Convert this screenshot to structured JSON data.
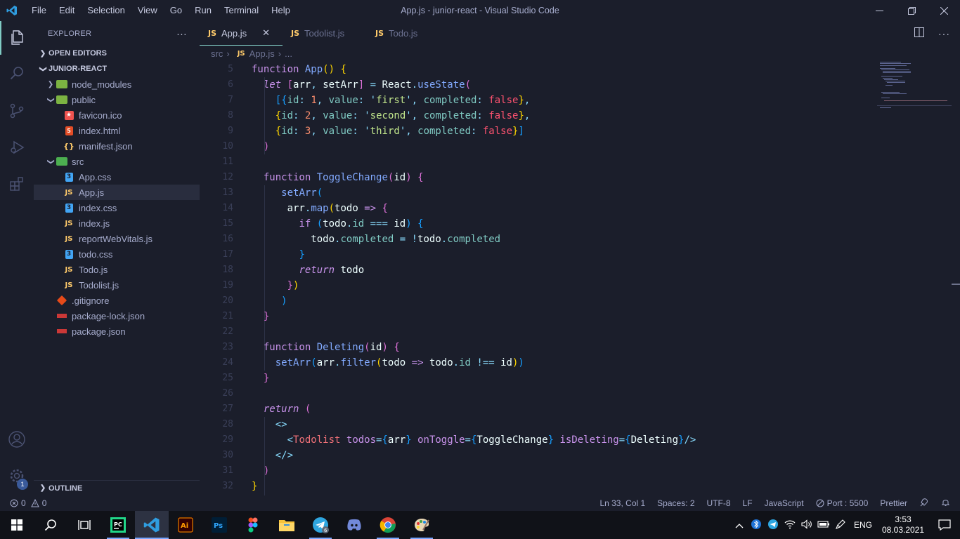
{
  "window": {
    "title": "App.js - junior-react - Visual Studio Code",
    "menu": [
      "File",
      "Edit",
      "Selection",
      "View",
      "Go",
      "Run",
      "Terminal",
      "Help"
    ]
  },
  "sidebar": {
    "header": "EXPLORER",
    "more": "···",
    "open_editors": "OPEN EDITORS",
    "project": "JUNIOR-REACT",
    "outline": "OUTLINE",
    "tree": [
      {
        "label": "node_modules",
        "type": "folder",
        "level": 1
      },
      {
        "label": "public",
        "type": "folder-open",
        "level": 1
      },
      {
        "label": "favicon.ico",
        "type": "favicon",
        "level": 2
      },
      {
        "label": "index.html",
        "type": "html",
        "level": 2
      },
      {
        "label": "manifest.json",
        "type": "json",
        "level": 2
      },
      {
        "label": "src",
        "type": "folder-open-src",
        "level": 1
      },
      {
        "label": "App.css",
        "type": "css",
        "level": 2
      },
      {
        "label": "App.js",
        "type": "js",
        "level": 2,
        "selected": true
      },
      {
        "label": "index.css",
        "type": "css",
        "level": 2
      },
      {
        "label": "index.js",
        "type": "js",
        "level": 2
      },
      {
        "label": "reportWebVitals.js",
        "type": "js",
        "level": 2
      },
      {
        "label": "todo.css",
        "type": "css",
        "level": 2
      },
      {
        "label": "Todo.js",
        "type": "js",
        "level": 2
      },
      {
        "label": "Todolist.js",
        "type": "js",
        "level": 2
      },
      {
        "label": ".gitignore",
        "type": "git",
        "level": 1
      },
      {
        "label": "package-lock.json",
        "type": "npm",
        "level": 1
      },
      {
        "label": "package.json",
        "type": "npm",
        "level": 1
      }
    ],
    "settings_badge": "1"
  },
  "tabs": [
    {
      "label": "App.js",
      "active": true
    },
    {
      "label": "Todolist.js",
      "active": false
    },
    {
      "label": "Todo.js",
      "active": false
    }
  ],
  "tab_icon": "JS",
  "breadcrumb": {
    "folder": "src",
    "file": "App.js",
    "more": "..."
  },
  "editor": {
    "line_numbers": [
      "5",
      "6",
      "7",
      "8",
      "9",
      "10",
      "11",
      "12",
      "13",
      "14",
      "15",
      "16",
      "17",
      "18",
      "19",
      "20",
      "21",
      "22",
      "23",
      "24",
      "25",
      "26",
      "27",
      "28",
      "29",
      "30",
      "31",
      "32"
    ]
  },
  "statusbar": {
    "errors": "0",
    "warnings": "0",
    "position": "Ln 33, Col 1",
    "spaces": "Spaces: 2",
    "encoding": "UTF-8",
    "eol": "LF",
    "language": "JavaScript",
    "port": "Port : 5500",
    "formatter": "Prettier"
  },
  "taskbar": {
    "language": "ENG",
    "time": "3:53",
    "date": "08.03.2021",
    "telegram_badge": "6"
  },
  "colors": {
    "background": "#1b1e2b",
    "accent": "#80cbc4",
    "keyword": "#c792ea",
    "function": "#82aaff",
    "string": "#c3e88d",
    "number": "#f78c6c"
  }
}
